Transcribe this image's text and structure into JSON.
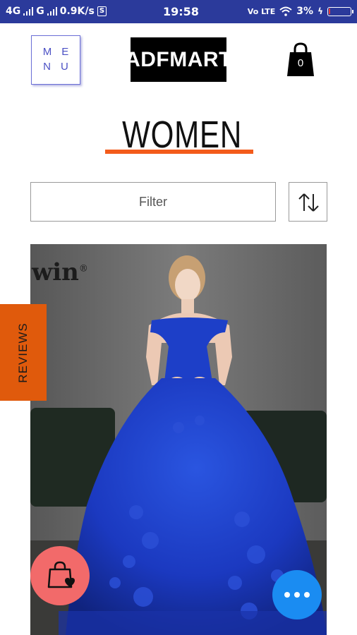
{
  "status_bar": {
    "network1": "4G",
    "network2": "G",
    "speed": "0.9K/s",
    "s_badge": "S",
    "time": "19:58",
    "volte": "Vo LTE",
    "battery": "3%"
  },
  "header": {
    "menu_line1": "ME",
    "menu_line2": "NU",
    "logo": "ADFMART",
    "cart_count": "0"
  },
  "page": {
    "title": "WOMEN"
  },
  "filter": {
    "placeholder": "Filter"
  },
  "product": {
    "watermark": "win",
    "watermark_mark": "®"
  },
  "side_tab": {
    "label": "REVIEWS"
  },
  "colors": {
    "status_bar": "#2b3a9b",
    "accent_orange": "#f35b1b",
    "reviews_tab": "#e05a0c",
    "fab_bag": "#f26a6a",
    "fab_more": "#1a8cf2",
    "menu_blue": "#4b50c4",
    "dress_blue": "#1e3fc4"
  },
  "icons": [
    "cart-bag-icon",
    "sort-arrows-icon",
    "shopping-bag-heart-icon",
    "more-dots-icon",
    "wifi-icon",
    "signal-icon",
    "battery-icon"
  ]
}
